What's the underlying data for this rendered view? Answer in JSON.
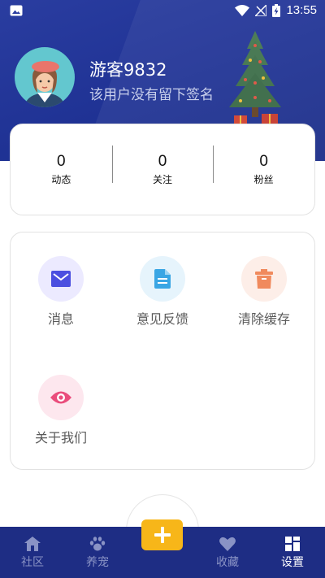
{
  "status_bar": {
    "time": "13:55"
  },
  "profile": {
    "name": "游客9832",
    "signature": "该用户没有留下签名"
  },
  "stats": [
    {
      "value": "0",
      "label": "动态"
    },
    {
      "value": "0",
      "label": "关注"
    },
    {
      "value": "0",
      "label": "粉丝"
    }
  ],
  "menu": [
    {
      "label": "消息",
      "icon": "mail-icon",
      "color": "#4b4fe0",
      "bg": "#eceaff"
    },
    {
      "label": "意见反馈",
      "icon": "document-icon",
      "color": "#3aa6e4",
      "bg": "#e6f4fc"
    },
    {
      "label": "清除缓存",
      "icon": "trash-icon",
      "color": "#f08a5d",
      "bg": "#fdeee8"
    },
    {
      "label": "关于我们",
      "icon": "eye-icon",
      "color": "#ea4d7c",
      "bg": "#fde7ee"
    }
  ],
  "nav": [
    {
      "label": "社区",
      "icon": "home-icon"
    },
    {
      "label": "养宠",
      "icon": "paw-icon"
    },
    {
      "label": "收藏",
      "icon": "heart-icon"
    },
    {
      "label": "设置",
      "icon": "grid-icon",
      "active": true
    }
  ],
  "colors": {
    "header": "#1f3294",
    "navbar": "#1e2d84",
    "add_button": "#f7b619"
  }
}
